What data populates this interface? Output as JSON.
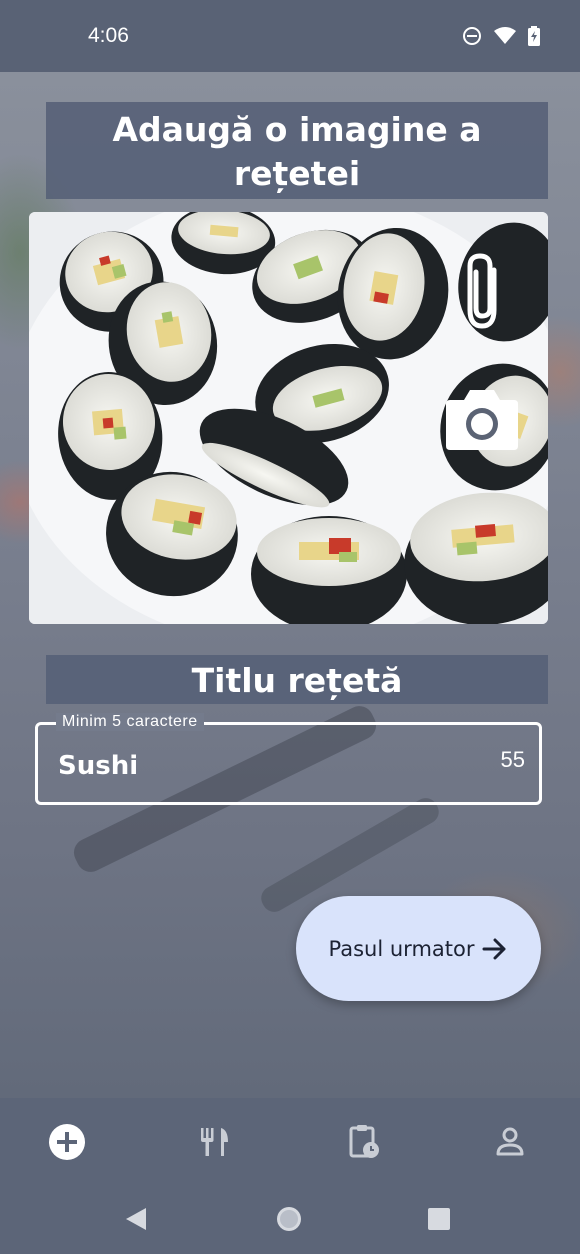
{
  "status_bar": {
    "time": "4:06",
    "icons": [
      "do-not-disturb-icon",
      "wifi-icon",
      "battery-charging-icon"
    ]
  },
  "image_section": {
    "title": "Adaugă o imagine a rețetei",
    "actions": [
      "attach-icon",
      "camera-icon"
    ]
  },
  "title_section": {
    "heading": "Titlu rețetă",
    "field_label": "Minim 5 caractere",
    "field_value": "Sushi",
    "counter": "55"
  },
  "next_button": {
    "label": "Pasul urmator",
    "icon": "arrow-right-icon"
  },
  "bottom_nav": {
    "items": [
      "add-icon",
      "restaurant-icon",
      "clipboard-clock-icon",
      "person-icon"
    ],
    "active_index": 0
  },
  "system_nav": [
    "back-icon",
    "home-icon",
    "recents-icon"
  ],
  "colors": {
    "status_bar": "#596275",
    "nav_bar": "#5c6578",
    "title_banner": "#556076",
    "button_bg": "#d9e3fb",
    "button_text": "#1c2233"
  }
}
